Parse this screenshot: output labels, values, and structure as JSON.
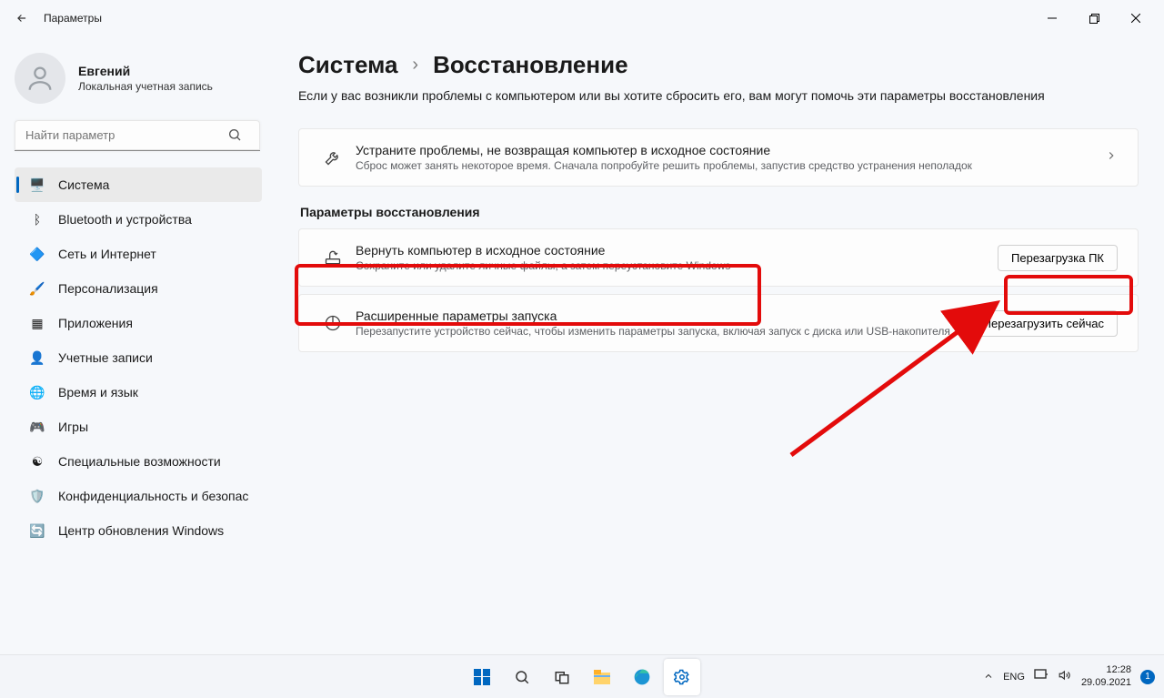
{
  "titlebar": {
    "title": "Параметры"
  },
  "user": {
    "name": "Евгений",
    "sub": "Локальная учетная запись"
  },
  "search": {
    "placeholder": "Найти параметр"
  },
  "nav": [
    {
      "icon": "🖥️",
      "label": "Система",
      "name": "nav-system",
      "selected": true
    },
    {
      "icon": "ᛒ",
      "label": "Bluetooth и устройства",
      "name": "nav-bluetooth"
    },
    {
      "icon": "🔷",
      "label": "Сеть и Интернет",
      "name": "nav-network"
    },
    {
      "icon": "🖌️",
      "label": "Персонализация",
      "name": "nav-personalization"
    },
    {
      "icon": "▦",
      "label": "Приложения",
      "name": "nav-apps"
    },
    {
      "icon": "👤",
      "label": "Учетные записи",
      "name": "nav-accounts"
    },
    {
      "icon": "🌐",
      "label": "Время и язык",
      "name": "nav-time-language"
    },
    {
      "icon": "🎮",
      "label": "Игры",
      "name": "nav-gaming"
    },
    {
      "icon": "☯",
      "label": "Специальные возможности",
      "name": "nav-accessibility"
    },
    {
      "icon": "🛡️",
      "label": "Конфиденциальность и безопас",
      "name": "nav-privacy"
    },
    {
      "icon": "🔄",
      "label": "Центр обновления Windows",
      "name": "nav-update"
    }
  ],
  "breadcrumb": {
    "root": "Система",
    "leaf": "Восстановление"
  },
  "intro": "Если у вас возникли проблемы с компьютером или вы хотите сбросить его, вам могут помочь эти параметры восстановления",
  "card_fix": {
    "title": "Устраните проблемы, не возвращая компьютер в исходное состояние",
    "sub": "Сброс может занять некоторое время. Сначала попробуйте решить проблемы, запустив средство устранения неполадок"
  },
  "section_header": "Параметры восстановления",
  "card_reset": {
    "title": "Вернуть компьютер в исходное состояние",
    "sub": "Сохраните или удалите личные файлы, а затем переустановите Windows",
    "button": "Перезагрузка ПК"
  },
  "card_adv": {
    "title": "Расширенные параметры запуска",
    "sub": "Перезапустите устройство сейчас, чтобы изменить параметры запуска, включая запуск с диска или USB-накопителя",
    "button": "Перезагрузить сейчас"
  },
  "tray": {
    "lang": "ENG",
    "time": "12:28",
    "date": "29.09.2021",
    "noti": "1"
  }
}
